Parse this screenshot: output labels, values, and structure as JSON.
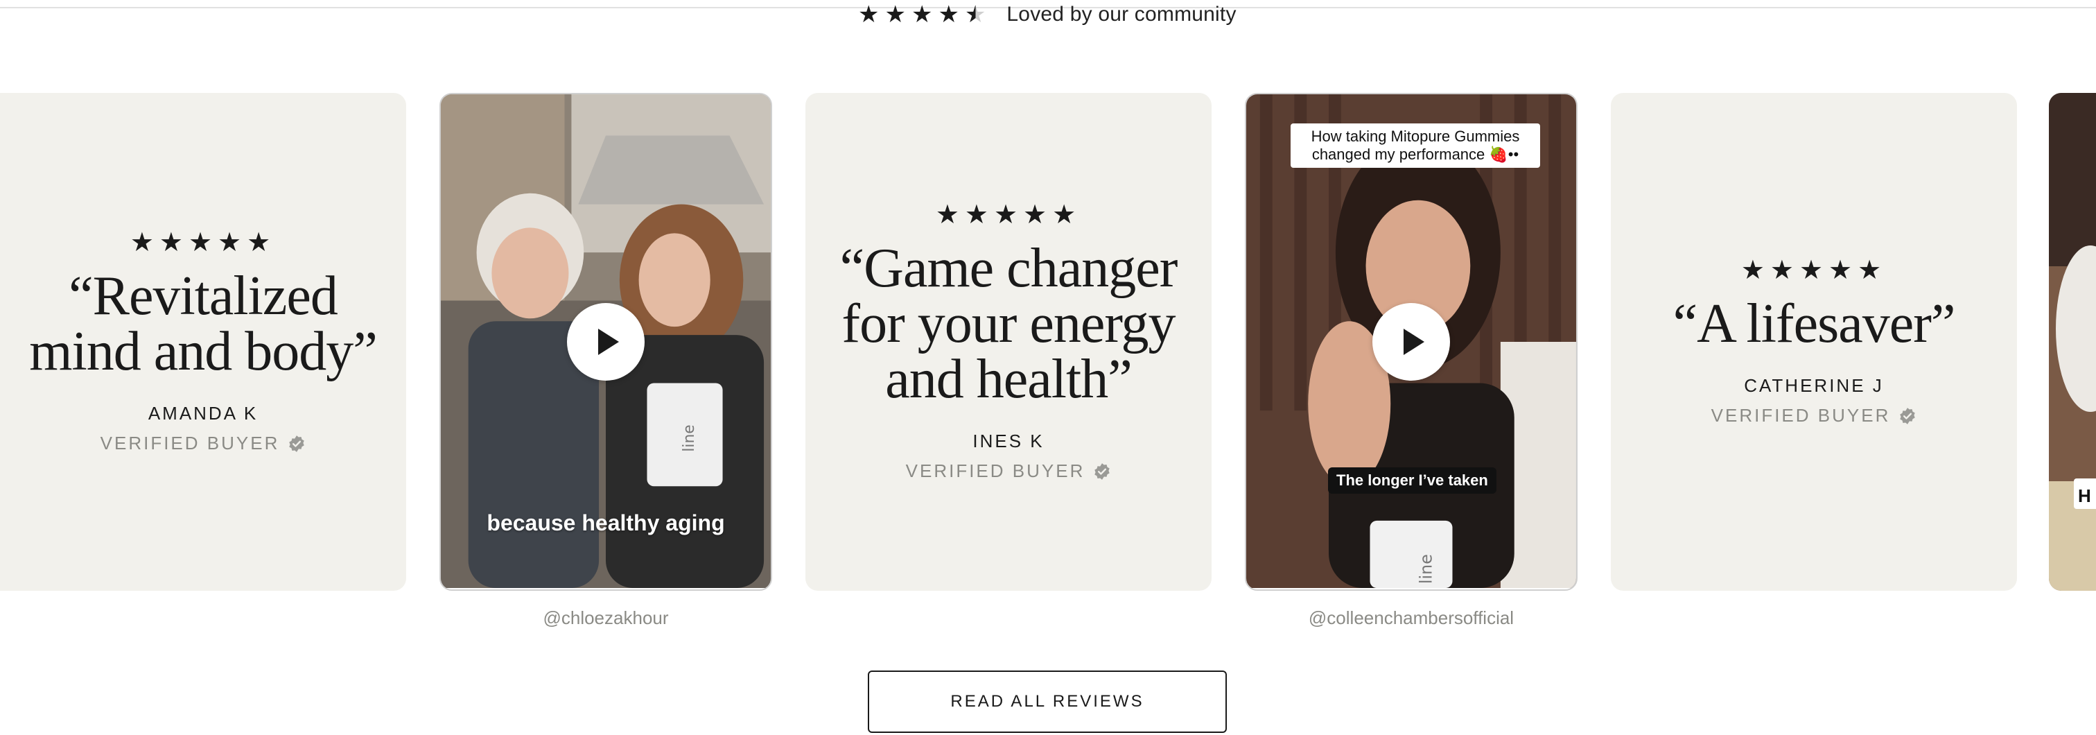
{
  "rating": {
    "stars": [
      "★",
      "★",
      "★",
      "★",
      "★"
    ],
    "tagline": "Loved by our community"
  },
  "cards": [
    {
      "stars": "★★★★★",
      "quote": "“Revitalized mind and body”",
      "author": "AMANDA K",
      "verified": "VERIFIED BUYER"
    },
    {
      "stars": "★★★★★",
      "quote": "“Game changer for your energy and health”",
      "author": "INES K",
      "verified": "VERIFIED BUYER"
    },
    {
      "stars": "★★★★★",
      "quote": "“A lifesaver”",
      "author": "CATHERINE J",
      "verified": "VERIFIED BUYER"
    }
  ],
  "videos": [
    {
      "caption": "because healthy aging",
      "handle": "@chloezakhour",
      "product_label": "line"
    },
    {
      "overlay": "How taking Mitopure Gummies changed my performance 🍓••",
      "caption": "The longer I’ve taken",
      "handle": "@colleenchambersofficial",
      "product_label": "line"
    }
  ],
  "edge_label": "H",
  "cta": {
    "label": "READ ALL REVIEWS"
  },
  "colors": {
    "card_bg": "#f2f1ec",
    "text": "#1a1a1a",
    "muted": "#8a8a85"
  },
  "icons": {
    "verified": "verified-badge-icon",
    "play": "play-icon"
  }
}
